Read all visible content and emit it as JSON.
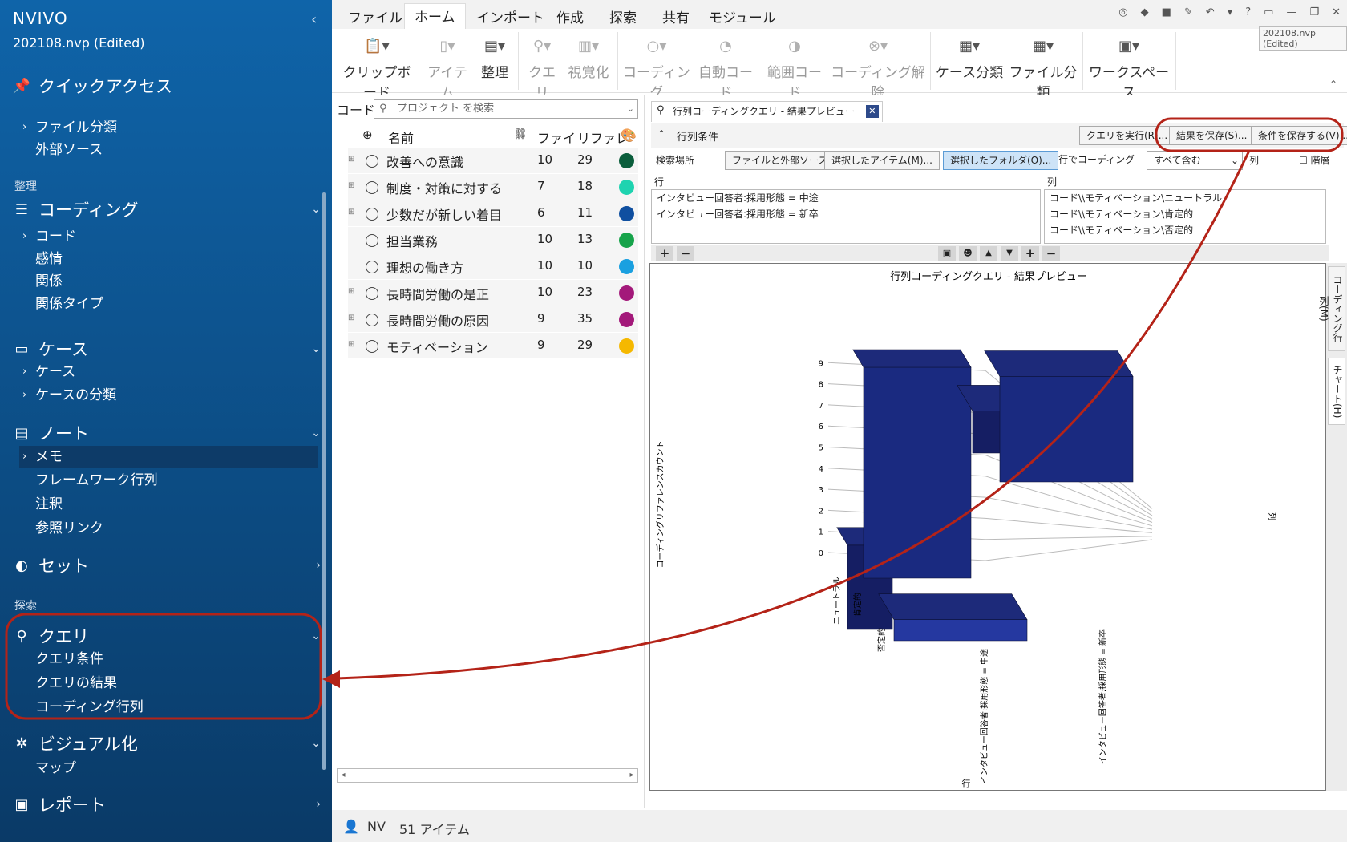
{
  "app": {
    "logo": "NVIVO",
    "project": "202108.nvp (Edited)",
    "tooltip": "202108.nvp (Edited)"
  },
  "sidebar": {
    "quick": "クイックアクセス",
    "quick_items": [
      "ファイル分類",
      "外部ソース"
    ],
    "sec_organize": "整理",
    "coding": "コーディング",
    "coding_items": [
      "コード",
      "感情",
      "関係",
      "関係タイプ"
    ],
    "cases": "ケース",
    "cases_items": [
      "ケース",
      "ケースの分類"
    ],
    "notes": "ノート",
    "notes_items": [
      "メモ",
      "フレームワーク行列",
      "注釈",
      "参照リンク"
    ],
    "sets": "セット",
    "sec_explore": "探索",
    "query": "クエリ",
    "query_items": [
      "クエリ条件",
      "クエリの結果",
      "コーディング行列"
    ],
    "visual": "ビジュアル化",
    "visual_items": [
      "マップ"
    ],
    "report": "レポート"
  },
  "menu": [
    "ファイル",
    "ホーム",
    "インポート",
    "作成",
    "探索",
    "共有",
    "モジュール"
  ],
  "ribbon": [
    "クリップボード",
    "アイテム",
    "整理",
    "クエリ",
    "視覚化",
    "コーディング",
    "自動コード",
    "範囲コード",
    "コーディング解除",
    "ケース分類",
    "ファイル分類",
    "ワークスペース"
  ],
  "codes": {
    "label": "コード",
    "search_placeholder": "プロジェクト を検索",
    "headers": {
      "name": "名前",
      "files": "ファイ",
      "refs": "リファレ"
    },
    "rows": [
      {
        "name": "改善への意識",
        "files": "10",
        "refs": "29",
        "color": "#0b5e3c",
        "expand": true
      },
      {
        "name": "制度・対策に対する",
        "files": "7",
        "refs": "18",
        "color": "#1ed3b0",
        "expand": true
      },
      {
        "name": "少数だが新しい着目",
        "files": "6",
        "refs": "11",
        "color": "#0f4fa0",
        "expand": true
      },
      {
        "name": "担当業務",
        "files": "10",
        "refs": "13",
        "color": "#16a34a",
        "expand": false
      },
      {
        "name": "理想の働き方",
        "files": "10",
        "refs": "10",
        "color": "#1aa0e0",
        "expand": false
      },
      {
        "name": "長時間労働の是正",
        "files": "10",
        "refs": "23",
        "color": "#a3197a",
        "expand": true
      },
      {
        "name": "長時間労働の原因",
        "files": "9",
        "refs": "35",
        "color": "#a3197a",
        "expand": true
      },
      {
        "name": "モティベーション",
        "files": "9",
        "refs": "29",
        "color": "#f5b800",
        "expand": true
      }
    ]
  },
  "query": {
    "tab": "行列コーディングクエリ - 結果プレビュー",
    "cond_title": "行列条件",
    "run": "クエリを実行(R)...",
    "save_result": "結果を保存(S)...",
    "save_cond": "条件を保存する(V)...",
    "search_in": "検索場所",
    "opt_files": "ファイルと外部ソース",
    "opt_items": "選択したアイテム(M)...",
    "opt_folders": "選択したフォルダ(O)...",
    "row_coding": "行でコーディング",
    "select_val": "すべて含む",
    "col": "列",
    "hierarchy": "階層",
    "row_label": "行",
    "col_label": "列",
    "rows": [
      "インタビュー回答者:採用形態 = 中途",
      "インタビュー回答者:採用形態 = 新卒"
    ],
    "cols": [
      "コード\\\\モティベーション\\ニュートラル",
      "コード\\\\モティベーション\\肯定的",
      "コード\\\\モティベーション\\否定的"
    ]
  },
  "chart_data": {
    "type": "bar",
    "title": "行列コーディングクエリ - 結果プレビュー",
    "ylabel": "コーディングリファレンスカウント",
    "xlabel": "行",
    "zlabel": "列",
    "ylim": [
      0,
      9
    ],
    "yticks": [
      "0",
      "1",
      "2",
      "3",
      "4",
      "5",
      "6",
      "7",
      "8",
      "9"
    ],
    "categories": [
      "インタビュー回答者:採用形態 = 中途",
      "インタビュー回答者:採用形態 = 新卒"
    ],
    "series": [
      {
        "name": "ニュートラル",
        "values": [
          4,
          2
        ]
      },
      {
        "name": "肯定的",
        "values": [
          10,
          5
        ]
      },
      {
        "name": "否定的",
        "values": [
          1,
          5
        ]
      }
    ],
    "colors": [
      "#151e63",
      "#1a2a80",
      "#2538a0"
    ]
  },
  "sidetabs": [
    "コーディング行列(M)",
    "チャート(H)"
  ],
  "status": {
    "user": "NV",
    "count": "51 アイテム"
  },
  "colors": {
    "sidebar_top": "#0f64a9",
    "sidebar_bottom": "#0a3a67",
    "annotation": "#b42318"
  }
}
